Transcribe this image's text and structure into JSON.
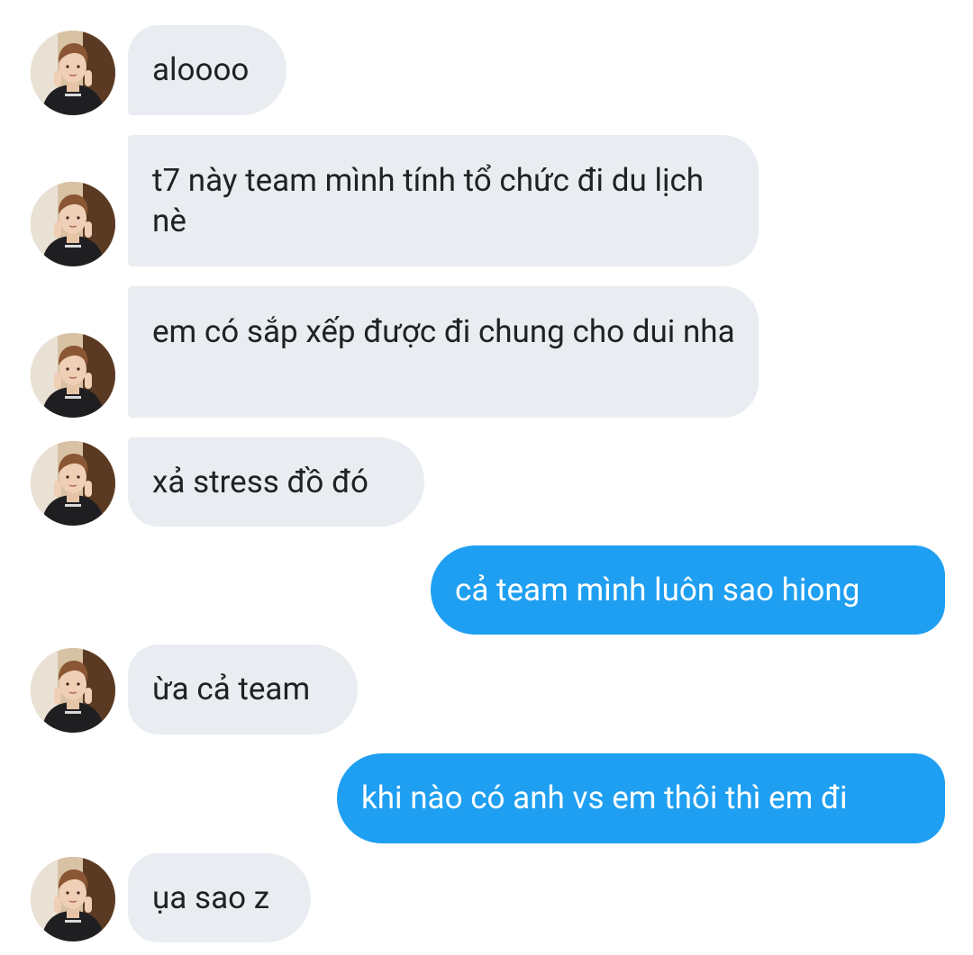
{
  "conversation": {
    "messages": [
      {
        "from": "them",
        "text": "aloooo"
      },
      {
        "from": "them",
        "text": "t7 này team mình tính tổ chức đi du lịch nè"
      },
      {
        "from": "them",
        "text": "em có sắp xếp được đi chung cho dui nha"
      },
      {
        "from": "them",
        "text": "xả stress đồ đó"
      },
      {
        "from": "me",
        "text": "cả team mình luôn sao hiong"
      },
      {
        "from": "them",
        "text": "ừa cả team"
      },
      {
        "from": "me",
        "text": "khi nào có anh vs em thôi thì em đi"
      },
      {
        "from": "them",
        "text": "ụa sao z"
      }
    ]
  },
  "colors": {
    "incoming_bubble": "#e9ecf0",
    "outgoing_bubble": "#1e9ff2",
    "incoming_text": "#202124",
    "outgoing_text": "#ffffff",
    "background": "#ffffff"
  },
  "icons": {
    "avatar": "contact-avatar"
  }
}
